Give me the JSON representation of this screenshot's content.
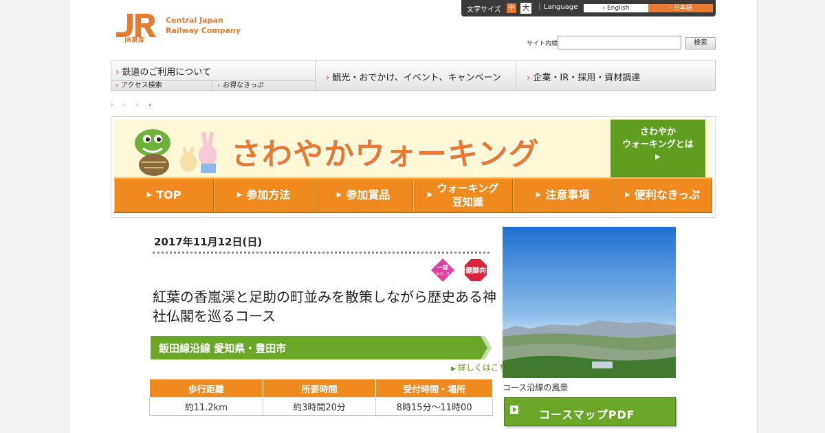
{
  "header": {
    "logo_text": "JR",
    "logo_sub": "JR東海",
    "company_line1": "Central Japan",
    "company_line2": "Railway Company",
    "font_size_label": "文字サイズ",
    "font_size_mid": "中",
    "font_size_big": "大",
    "language_label": "Language",
    "lang_english": "› English",
    "lang_japanese": "› 日本語",
    "search_label": "サイト内検索",
    "search_placeholder": "",
    "search_button": "検索"
  },
  "global_nav": {
    "item1": "鉄道のご利用について",
    "sub1": "アクセス検索",
    "sub2": "お得なきっぷ",
    "item2": "観光・おでかけ、イベント、キャンペーン",
    "item3": "企業・IR・採用・資材調達"
  },
  "banner": {
    "title": "さわやかウォーキング",
    "about_line1": "さわやか",
    "about_line2": "ウォーキングとは",
    "about_arrow": "▶",
    "nav": [
      {
        "label": "TOP"
      },
      {
        "label": "参加方法"
      },
      {
        "label": "参加賞品"
      },
      {
        "label": "ウォーキング\n豆知識"
      },
      {
        "label": "注意事項"
      },
      {
        "label": "便利なきっぷ"
      }
    ]
  },
  "event": {
    "date": "2017年11月12日(日)",
    "badge1_line1": "一部",
    "badge1_line2": "山コース",
    "badge2": "健脚向",
    "title": "紅葉の香嵐渓と足助の町並みを散策しながら歴史ある神社仏閣を巡るコース",
    "area_bar": "飯田線沿線 愛知県・豊田市",
    "detail_link": "詳しくはこちら",
    "table_headers": [
      "歩行距離",
      "所要時間",
      "受付時間・場所"
    ],
    "table_values": [
      "約11.2km",
      "約3時間20分",
      "8時15分～11時00"
    ],
    "photo_caption": "コース沿線の風景",
    "pdf_button": "コースマップPDF"
  },
  "colors": {
    "orange": "#ef8a1e",
    "green": "#5f9d1f",
    "jr_orange": "#e8792f"
  }
}
